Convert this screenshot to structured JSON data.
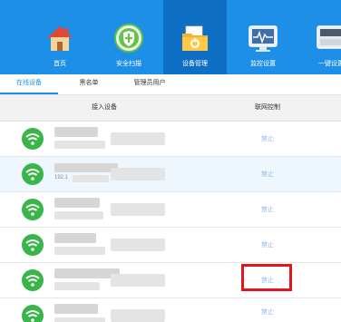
{
  "nav": {
    "items": [
      {
        "label": "首页",
        "icon": "home-icon"
      },
      {
        "label": "安全扫描",
        "icon": "shield-icon"
      },
      {
        "label": "设备管理",
        "icon": "device-folder-icon"
      },
      {
        "label": "监控设置",
        "icon": "monitor-icon"
      },
      {
        "label": "一键设置",
        "icon": "router-icon"
      }
    ],
    "active_index": 2
  },
  "tabs": [
    {
      "label": "在线设备",
      "active": true
    },
    {
      "label": "黑名单",
      "active": false
    },
    {
      "label": "管理员用户",
      "active": false
    }
  ],
  "table": {
    "headers": {
      "device": "接入设备",
      "control": "联网控制"
    },
    "rows": [
      {
        "device_id": "",
        "action": "禁止"
      },
      {
        "device_id": "192.1",
        "action": "禁止"
      },
      {
        "device_id": "",
        "action": "禁止"
      },
      {
        "device_id": "",
        "action": "禁止"
      },
      {
        "device_id": "",
        "action": "禁止"
      },
      {
        "device_id": "",
        "action": "禁止"
      }
    ]
  },
  "colors": {
    "nav_bg": "#1d8fe6",
    "nav_active_bg": "#0f6fc4",
    "wifi_green": "#3ab54a",
    "highlight_red": "#e2151d",
    "ban_link": "#8fb8e6"
  }
}
